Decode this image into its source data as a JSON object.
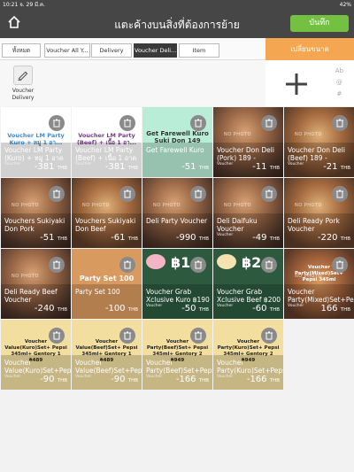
{
  "status": {
    "time": "10:21",
    "date": "จ. 29 มี.ค.",
    "battery": "42%"
  },
  "header": {
    "title": "แตะค้างบนสิ่งที่ต้องการย้าย",
    "save_label": "บันทึก"
  },
  "tabs": [
    {
      "label": "ทั้งหมด",
      "active": false
    },
    {
      "label": "Voucher All Y...",
      "active": false
    },
    {
      "label": "Delivery",
      "active": false
    },
    {
      "label": "Voucher Deli...",
      "active": true
    },
    {
      "label": "Item",
      "active": false
    }
  ],
  "resize_label": "เปลี่ยนขนาด",
  "category": {
    "label": "Voucher Delivery"
  },
  "side_labels": [
    "Ab",
    "@",
    "#"
  ],
  "colors": {
    "header": "#464646",
    "save": "#74c043",
    "resize": "#f4a750"
  },
  "cards": [
    {
      "style": "white",
      "top": "Voucher LM Party Kuro + หมู 1 อา...",
      "top_color": "#3a8fd6",
      "name": "Voucher LM Party (Kuro) + หมู 1 อาด",
      "sub": "Voucher",
      "price": "-381",
      "currency": "THB"
    },
    {
      "style": "white",
      "top": "Voucher LM Party (Beef) + เนื้อ 1 อา...",
      "top_color": "#7a3a8a",
      "name": "Voucher LM Party (Beef) + เนื้อ 1 อาด",
      "sub": "Voucher",
      "price": "-381",
      "currency": "THB"
    },
    {
      "style": "mint",
      "top": "Get Farewell Kuro Suki Don 149",
      "top_color": "#333333",
      "name": "Get Farewell Kuro",
      "sub": "",
      "price": "-51",
      "currency": "THB"
    },
    {
      "style": "photo",
      "top": "",
      "name": "Voucher Don Deli (Pork) 189 -",
      "sub": "Voucher",
      "price": "-11",
      "currency": "THB"
    },
    {
      "style": "photo2",
      "top": "",
      "name": "Voucher Don Deli (Beef) 189 -",
      "sub": "Voucher",
      "price": "-21",
      "currency": "THB"
    },
    {
      "style": "photo",
      "top": "",
      "name": "Vouchers Sukiyaki Don Pork",
      "sub": "",
      "price": "-51",
      "currency": "THB"
    },
    {
      "style": "photo2",
      "top": "",
      "name": "Vouchers Sukiyaki Don Beef",
      "sub": "",
      "price": "-61",
      "currency": "THB"
    },
    {
      "style": "photo",
      "top": "",
      "name": "Deli Party Voucher",
      "sub": "",
      "price": "-990",
      "currency": "THB"
    },
    {
      "style": "photo",
      "top": "",
      "name": "Deli Daifuku Voucher",
      "sub": "Voucher",
      "price": "-49",
      "currency": "THB"
    },
    {
      "style": "photo2",
      "top": "",
      "name": "Deli Ready Pork Voucher",
      "sub": "",
      "price": "-220",
      "currency": "THB"
    },
    {
      "style": "photo",
      "top": "",
      "name": "Deli Ready Beef Voucher",
      "sub": "",
      "price": "-240",
      "currency": "THB"
    },
    {
      "style": "orange",
      "top": "Party Set 100",
      "top_color": "#ffffff",
      "name": "Party Set 100",
      "sub": "",
      "price": "-100",
      "currency": "THB"
    },
    {
      "style": "green",
      "top": "฿1",
      "top_color": "#ffffff",
      "name": "Voucher Grab Xclusive Kuro ฿190",
      "sub": "Voucher",
      "price": "-50",
      "currency": "THB",
      "logo": "pig-logo"
    },
    {
      "style": "green",
      "top": "฿2",
      "top_color": "#ffffff",
      "name": "Voucher Grab Xclusive Beef ฿200",
      "sub": "Voucher",
      "price": "-60",
      "currency": "THB",
      "logo": "cow-logo"
    },
    {
      "style": "photo3",
      "top": "Voucher Party(Mixed)Set+ Pepsi 345ml",
      "top_color": "#ffffff",
      "name": "Voucher Party(Mixed)Set+Pepsi",
      "sub": "Voucher",
      "price": "166",
      "currency": "THB"
    },
    {
      "style": "cream",
      "top": "Voucher Value(Kuro)Set+ Pepsi 345ml+ Gentory 1 ฿489",
      "top_color": "#222222",
      "name": "Voucher Value(Kuro)Set+Pepsi",
      "sub": "Voucher",
      "price": "-90",
      "currency": "THB"
    },
    {
      "style": "cream",
      "top": "Voucher Value(Beef)Set+ Pepsi 345ml+ Gentory 1 ฿489",
      "top_color": "#222222",
      "name": "Voucher Value(Beef)Set+Pepsi",
      "sub": "Voucher",
      "price": "-90",
      "currency": "THB"
    },
    {
      "style": "cream",
      "top": "Voucher Party(Beef)Set+ Pepsi 345ml+ Gentory 2 ฿949",
      "top_color": "#222222",
      "name": "Voucher Party(Beef)Set+Pepsi",
      "sub": "Voucher",
      "price": "-166",
      "currency": "THB"
    },
    {
      "style": "cream",
      "top": "Voucher Party(Kuro)Set+ Pepsi 345ml+ Gentory 2 ฿949",
      "top_color": "#222222",
      "name": "Voucher Party(Kuro)Set+Pepsi",
      "sub": "Voucher",
      "price": "-166",
      "currency": "THB"
    }
  ],
  "nophoto_label": "NO PHOTO"
}
